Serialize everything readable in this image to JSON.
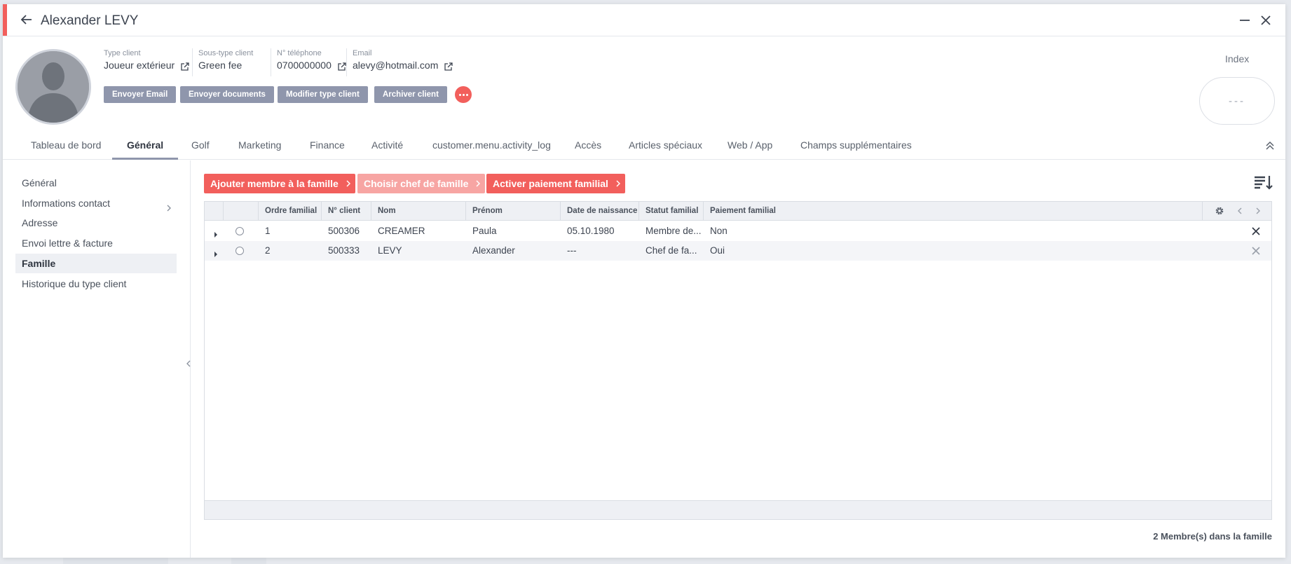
{
  "window": {
    "title": "Alexander LEVY"
  },
  "profile": {
    "fields": [
      {
        "label": "Type client",
        "value": "Joueur extérieur"
      },
      {
        "label": "Sous-type client",
        "value": "Green fee"
      },
      {
        "label": "N° téléphone",
        "value": "0700000000"
      },
      {
        "label": "Email",
        "value": "alevy@hotmail.com"
      }
    ],
    "actions": {
      "send_email": "Envoyer Email",
      "send_documents": "Envoyer documents",
      "modify_type": "Modifier type client",
      "archive": "Archiver client"
    },
    "index_label": "Index",
    "index_value": "---"
  },
  "tabs": [
    {
      "label": "Tableau de bord"
    },
    {
      "label": "Général",
      "active": true
    },
    {
      "label": "Golf"
    },
    {
      "label": "Marketing"
    },
    {
      "label": "Finance"
    },
    {
      "label": "Activité"
    },
    {
      "label": "customer.menu.activity_log"
    },
    {
      "label": "Accès"
    },
    {
      "label": "Articles spéciaux"
    },
    {
      "label": "Web / App"
    },
    {
      "label": "Champs supplémentaires"
    }
  ],
  "sidebar": {
    "items": [
      {
        "label": "Général"
      },
      {
        "label": "Informations contact"
      },
      {
        "label": "Adresse"
      },
      {
        "label": "Envoi lettre & facture"
      },
      {
        "label": "Famille",
        "active": true
      },
      {
        "label": "Historique du type client"
      }
    ]
  },
  "family": {
    "buttons": {
      "add_member": "Ajouter membre à la famille",
      "choose_head": "Choisir chef de famille",
      "activate_payment": "Activer paiement familial"
    },
    "columns": [
      "Ordre familial",
      "N° client",
      "Nom",
      "Prénom",
      "Date de naissance",
      "Statut familial",
      "Paiement familial"
    ],
    "rows": [
      {
        "order": "1",
        "client_no": "500306",
        "last_name": "CREAMER",
        "first_name": "Paula",
        "birth_date": "05.10.1980",
        "status": "Membre de...",
        "payment": "Non"
      },
      {
        "order": "2",
        "client_no": "500333",
        "last_name": "LEVY",
        "first_name": "Alexander",
        "birth_date": "---",
        "status": "Chef de fa...",
        "payment": "Oui"
      }
    ],
    "members_count": "2 Membre(s) dans la famille"
  },
  "colors": {
    "accent": "#f25f5c",
    "accent_disabled": "#f7a5a3",
    "action_button": "#8f96ac"
  },
  "icons": [
    "back-arrow-icon",
    "minimize-icon",
    "close-icon",
    "external-link-icon",
    "more-dots-icon",
    "collapse-up-icon",
    "chevron-right-icon",
    "sort-list-icon",
    "settings-gear-icon",
    "chevron-left-icon",
    "expand-row-icon",
    "delete-x-icon"
  ]
}
